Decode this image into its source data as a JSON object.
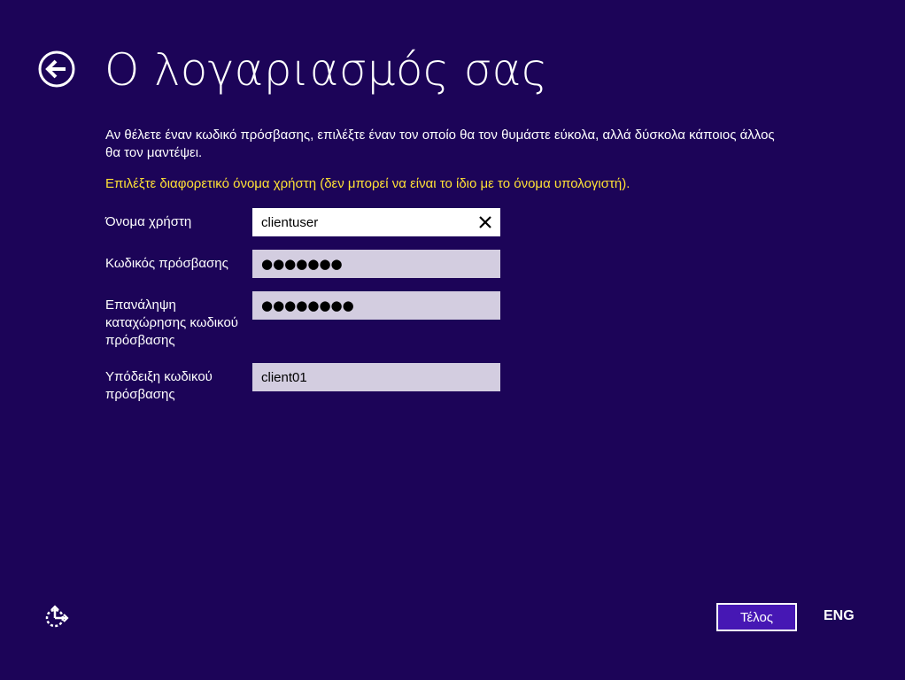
{
  "header": {
    "back_icon": "back-arrow-circle-icon",
    "title": "Ο λογαριασμός σας"
  },
  "main": {
    "description": "Αν θέλετε έναν κωδικό πρόσβασης, επιλέξτε έναν τον οποίο θα τον θυμάστε εύκολα, αλλά δύσκολα κάποιος άλλος θα τον μαντέψει.",
    "warning": "Επιλέξτε διαφορετικό όνομα χρήστη (δεν μπορεί να είναι το ίδιο με το όνομα υπολογιστή).",
    "fields": {
      "username": {
        "label": "Όνομα χρήστη",
        "value": "clientuser",
        "clear_icon": "close-x-icon"
      },
      "password": {
        "label": "Κωδικός πρόσβασης",
        "value": "●●●●●●●"
      },
      "password_confirm": {
        "label": "Επανάληψη καταχώρησης κωδικού πρόσβασης",
        "value": "●●●●●●●●"
      },
      "hint": {
        "label": "Υπόδειξη κωδικού πρόσβασης",
        "value": "client01"
      }
    }
  },
  "footer": {
    "ease_of_access_icon": "ease-of-access-icon",
    "finish_label": "Τέλος",
    "language": "ENG"
  },
  "colors": {
    "background": "#1c0458",
    "warning_text": "#ffe135",
    "input_inactive": "#d3cde0",
    "input_active": "#ffffff",
    "button_fill": "#4617b4"
  }
}
